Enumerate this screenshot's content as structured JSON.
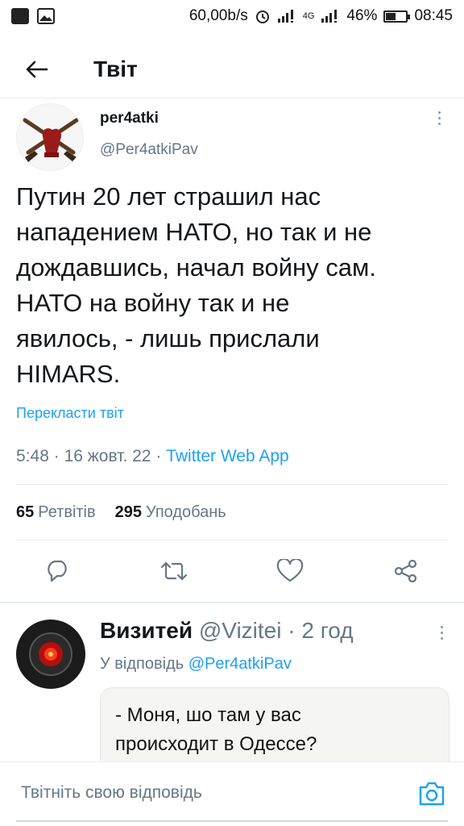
{
  "status_bar": {
    "speed": "60,00b/s",
    "network_label": "4G",
    "battery": "46%",
    "battery_level": 0.46,
    "time": "08:45"
  },
  "app_bar": {
    "title": "Твіт",
    "back_icon": "arrow-left-icon"
  },
  "tweet": {
    "author_name": "per4atki",
    "author_handle": "@Per4atkiPav",
    "text_lines": [
      "Путин 20 лет страшил нас",
      "нападением НАТО, но так и не",
      "дождавшись, начал войну сам.",
      "НАТО на войну так и не",
      "явилось, - лишь прислали",
      "HIMARS."
    ],
    "translate_label": "Перекласти твіт",
    "time": "5:48",
    "date": "16 жовт. 22",
    "separator": "·",
    "source_app": "Twitter Web App",
    "retweets_count": "65",
    "retweets_label": "Ретвітів",
    "likes_count": "295",
    "likes_label": "Уподобань",
    "actions": [
      "reply-icon",
      "retweet-icon",
      "like-icon",
      "share-icon"
    ]
  },
  "reply": {
    "author_name": "Визитей",
    "author_handle": "@Vizitei",
    "separator": "·",
    "age": "2 год",
    "replying_to_label": "У відповідь",
    "replying_to_handle": "@Per4atkiPav",
    "media_lines": [
      "- Моня, шо там у вас",
      "происходит в Одессе?"
    ]
  },
  "compose": {
    "placeholder": "Твітніть свою відповідь",
    "camera_icon": "camera-icon"
  },
  "colors": {
    "accent": "#1da1f2",
    "secondary_text": "#657786",
    "divider": "#e6ecf0"
  }
}
